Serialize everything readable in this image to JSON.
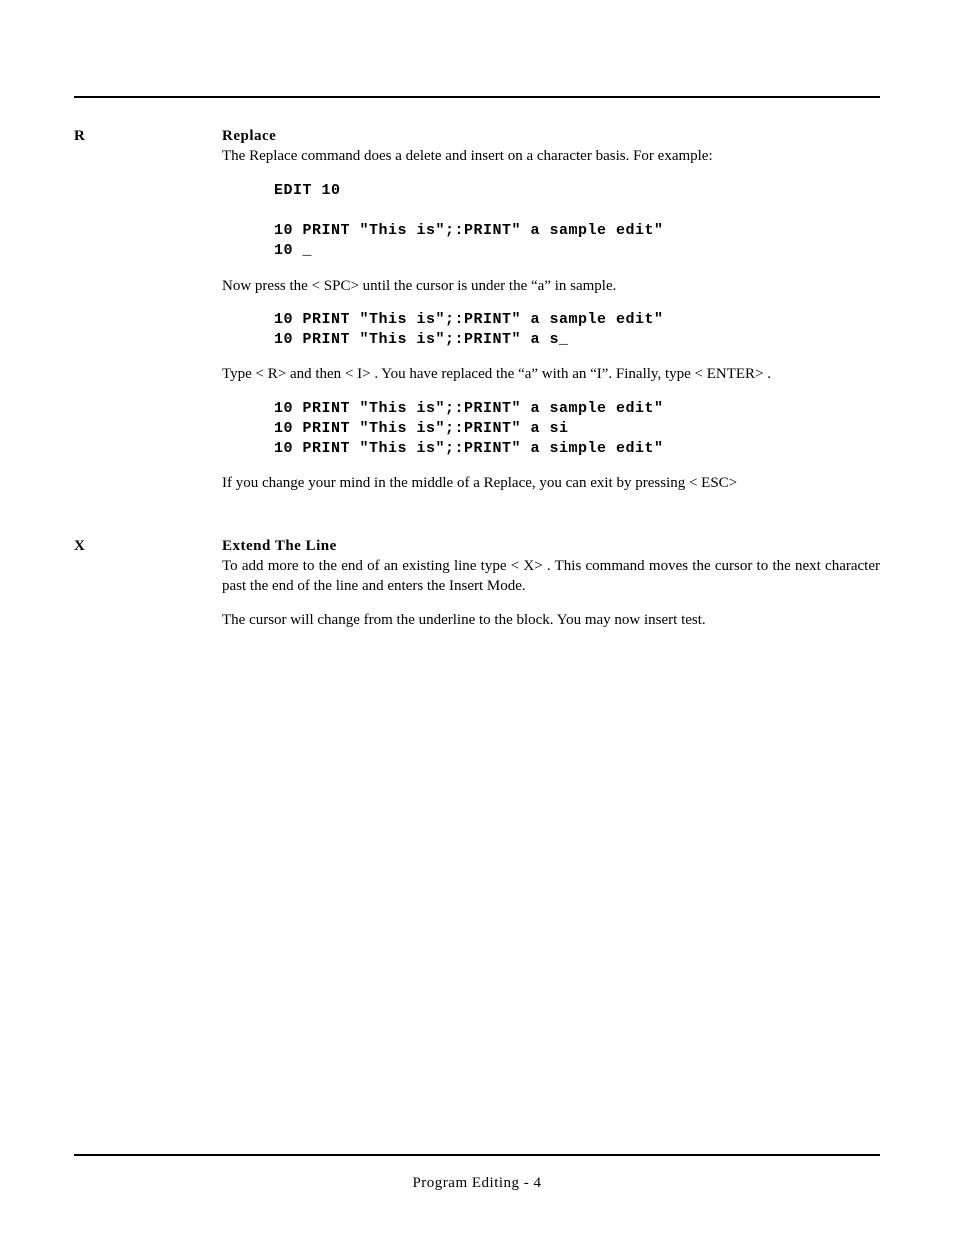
{
  "sections": [
    {
      "key": "R",
      "title": "Replace",
      "blocks": [
        {
          "type": "para",
          "text": "The Replace command does a delete and insert on a character basis.  For example:"
        },
        {
          "type": "code",
          "text": "EDIT 10\n\n10 PRINT \"This is\";:PRINT\" a sample edit\"\n10 _"
        },
        {
          "type": "para",
          "text": "Now press the < SPC>  until the cursor is under the “a” in sample."
        },
        {
          "type": "code",
          "text": "10 PRINT \"This is\";:PRINT\" a sample edit\"\n10 PRINT \"This is\";:PRINT\" a s_"
        },
        {
          "type": "para",
          "text": "Type < R>  and then < I> .  You have replaced the “a” with an “I”.  Finally, type < ENTER> ."
        },
        {
          "type": "code",
          "text": "10 PRINT \"This is\";:PRINT\" a sample edit\"\n10 PRINT \"This is\";:PRINT\" a si\n10 PRINT \"This is\";:PRINT\" a simple edit\""
        },
        {
          "type": "para",
          "text": "If you change your mind in the middle of a Replace, you can exit by pressing < ESC>"
        }
      ]
    },
    {
      "key": "X",
      "title": "Extend The Line",
      "blocks": [
        {
          "type": "para",
          "text": "To add more to the end of an existing line type < X> .  This command moves the cursor to the next character past the end of the line and enters the Insert Mode."
        },
        {
          "type": "para",
          "text": "The cursor will change from the underline to the block.  You may now insert test."
        }
      ]
    }
  ],
  "footer": "Program Editing - 4"
}
